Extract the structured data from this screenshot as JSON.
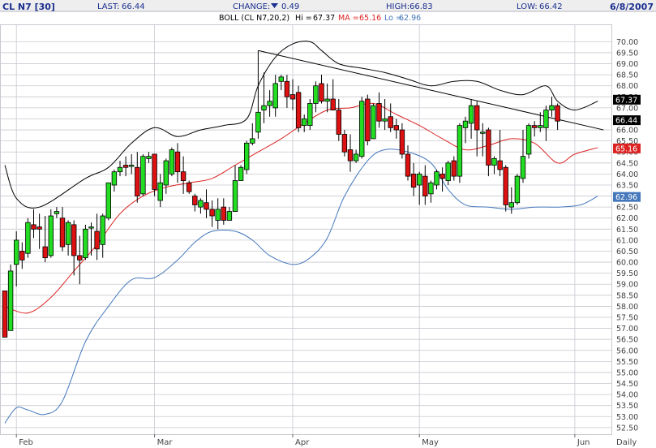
{
  "header": {
    "symbol": "CL N7 [30]",
    "last_label": "LAST:",
    "last_value": "66.44",
    "change_label": "CHANGE:",
    "change_icon": "down-triangle-icon",
    "change_value": "0.49",
    "high_label": "HIGH:",
    "high_value": "66.83",
    "low_label": "LOW:",
    "low_value": "66.42",
    "date": "6/8/2007"
  },
  "indicator": {
    "label": "BOLL (CL N7,20,2)",
    "hi_label": "Hi =",
    "hi_value": "67.37",
    "ma_label": "MA =",
    "ma_value": "65.16",
    "lo_label": "Lo =",
    "lo_value": "62.96"
  },
  "colors": {
    "up_candle": "#22dd22",
    "down_candle": "#dd1111",
    "upper_band": "#000000",
    "middle_band": "#dd2222",
    "lower_band": "#4477bb",
    "trendline": "#000000",
    "header_blue": "#1a2f8f",
    "grid": "#c8c8d0"
  },
  "chart_data": {
    "type": "candlestick",
    "ylim": [
      52.2,
      70.75
    ],
    "y_ticks": [
      "70.00",
      "69.50",
      "69.00",
      "68.50",
      "68.00",
      "67.50",
      "67.00",
      "66.50",
      "66.00",
      "65.50",
      "65.00",
      "64.50",
      "64.00",
      "63.50",
      "63.00",
      "62.50",
      "62.00",
      "61.50",
      "61.00",
      "60.50",
      "60.00",
      "59.50",
      "59.00",
      "58.50",
      "58.00",
      "57.50",
      "57.00",
      "56.50",
      "56.00",
      "55.50",
      "55.00",
      "54.50",
      "54.00",
      "53.50",
      "53.00",
      "52.50"
    ],
    "x_labels": [
      {
        "label": "Feb",
        "index": 2
      },
      {
        "label": "Mar",
        "index": 26
      },
      {
        "label": "Apr",
        "index": 50
      },
      {
        "label": "May",
        "index": 72
      },
      {
        "label": "Jun",
        "index": 99
      }
    ],
    "x_axis_right_label": "Daily",
    "last_markers": {
      "hi": "67.37",
      "last": "66.44",
      "ma": "65.16",
      "lo": "62.96"
    },
    "candles": [
      [
        58.7,
        58.6,
        56.6,
        56.6
      ],
      [
        56.9,
        59.9,
        56.9,
        59.6
      ],
      [
        59.9,
        61.4,
        58.9,
        61.0
      ],
      [
        60.5,
        60.9,
        59.7,
        60.1
      ],
      [
        60.4,
        62.0,
        60.2,
        61.8
      ],
      [
        61.7,
        62.4,
        61.1,
        61.5
      ],
      [
        61.6,
        62.2,
        60.6,
        61.5
      ],
      [
        60.7,
        62.1,
        60.0,
        60.2
      ],
      [
        60.3,
        62.4,
        60.2,
        62.1
      ],
      [
        62.2,
        62.5,
        62.0,
        62.3
      ],
      [
        62.0,
        62.5,
        60.5,
        60.7
      ],
      [
        60.8,
        61.9,
        60.3,
        61.8
      ],
      [
        61.7,
        61.9,
        59.4,
        60.3
      ],
      [
        60.3,
        61.2,
        59.0,
        60.1
      ],
      [
        60.2,
        61.7,
        60.1,
        61.5
      ],
      [
        61.6,
        61.8,
        60.3,
        61.6
      ],
      [
        61.4,
        62.2,
        60.1,
        60.6
      ],
      [
        60.8,
        62.2,
        60.2,
        62.1
      ],
      [
        62.0,
        63.6,
        61.9,
        63.6
      ],
      [
        63.5,
        64.2,
        63.2,
        64.1
      ],
      [
        64.1,
        64.6,
        63.9,
        64.3
      ],
      [
        64.4,
        64.8,
        63.9,
        64.3
      ],
      [
        64.4,
        64.9,
        64.0,
        64.4
      ],
      [
        64.3,
        65.0,
        62.7,
        63.0
      ],
      [
        63.1,
        64.9,
        63.0,
        64.8
      ],
      [
        64.7,
        65.0,
        64.5,
        64.8
      ],
      [
        64.9,
        64.9,
        63.0,
        63.3
      ],
      [
        62.8,
        64.0,
        62.5,
        63.6
      ],
      [
        63.5,
        64.7,
        63.1,
        64.6
      ],
      [
        64.0,
        65.2,
        63.9,
        65.1
      ],
      [
        65.0,
        65.4,
        63.6,
        64.1
      ],
      [
        64.1,
        64.8,
        63.1,
        63.7
      ],
      [
        63.6,
        63.7,
        63.1,
        63.2
      ],
      [
        63.0,
        63.1,
        62.3,
        62.6
      ],
      [
        62.5,
        62.9,
        62.2,
        62.8
      ],
      [
        62.7,
        63.3,
        62.0,
        62.4
      ],
      [
        62.4,
        62.8,
        61.6,
        62.1
      ],
      [
        61.9,
        62.9,
        61.5,
        62.4
      ],
      [
        62.5,
        62.9,
        61.7,
        61.9
      ],
      [
        61.9,
        62.5,
        61.9,
        62.3
      ],
      [
        62.3,
        64.4,
        62.3,
        63.7
      ],
      [
        63.7,
        64.4,
        63.7,
        64.3
      ],
      [
        64.2,
        65.5,
        64.0,
        65.4
      ],
      [
        65.4,
        66.3,
        65.3,
        65.6
      ],
      [
        65.9,
        69.6,
        65.6,
        66.8
      ],
      [
        66.9,
        68.6,
        66.3,
        67.1
      ],
      [
        67.1,
        67.8,
        66.6,
        67.3
      ],
      [
        67.0,
        68.5,
        66.6,
        68.1
      ],
      [
        68.2,
        68.5,
        67.8,
        68.4
      ],
      [
        68.2,
        68.5,
        67.0,
        67.5
      ],
      [
        67.6,
        68.3,
        66.9,
        67.4
      ],
      [
        67.7,
        68.0,
        65.9,
        66.1
      ],
      [
        66.2,
        66.7,
        65.9,
        66.5
      ],
      [
        66.2,
        67.4,
        66.0,
        67.2
      ],
      [
        67.2,
        68.2,
        66.8,
        68.0
      ],
      [
        68.1,
        68.5,
        67.2,
        67.3
      ],
      [
        67.3,
        68.1,
        66.8,
        67.4
      ],
      [
        67.4,
        68.3,
        66.9,
        66.9
      ],
      [
        66.9,
        67.4,
        65.5,
        65.8
      ],
      [
        65.8,
        66.0,
        64.8,
        65.0
      ],
      [
        65.1,
        65.8,
        64.1,
        64.6
      ],
      [
        64.6,
        65.1,
        64.5,
        64.9
      ],
      [
        64.8,
        67.5,
        64.7,
        67.3
      ],
      [
        67.4,
        67.6,
        65.3,
        65.5
      ],
      [
        65.6,
        67.2,
        65.6,
        67.1
      ],
      [
        67.2,
        67.7,
        66.1,
        66.4
      ],
      [
        66.4,
        67.4,
        66.0,
        66.5
      ],
      [
        66.6,
        67.2,
        65.9,
        66.1
      ],
      [
        66.2,
        66.5,
        65.6,
        66.0
      ],
      [
        66.0,
        66.3,
        64.7,
        64.9
      ],
      [
        64.9,
        65.3,
        63.7,
        63.9
      ],
      [
        64.0,
        64.5,
        63.0,
        63.4
      ],
      [
        63.5,
        64.1,
        62.6,
        64.0
      ],
      [
        63.9,
        64.4,
        62.6,
        63.0
      ],
      [
        63.1,
        63.7,
        62.7,
        63.6
      ],
      [
        63.5,
        64.2,
        63.3,
        64.1
      ],
      [
        64.0,
        64.3,
        63.2,
        63.8
      ],
      [
        63.7,
        64.6,
        63.5,
        64.5
      ],
      [
        64.6,
        64.8,
        63.7,
        63.9
      ],
      [
        63.9,
        66.3,
        63.6,
        66.2
      ],
      [
        66.1,
        66.6,
        65.4,
        66.4
      ],
      [
        66.3,
        67.4,
        65.6,
        67.1
      ],
      [
        67.1,
        67.3,
        64.8,
        66.0
      ],
      [
        65.9,
        66.3,
        64.8,
        65.9
      ],
      [
        66.0,
        66.1,
        63.9,
        64.4
      ],
      [
        64.4,
        64.8,
        64.0,
        64.7
      ],
      [
        64.6,
        66.0,
        63.9,
        64.2
      ],
      [
        64.3,
        64.4,
        62.3,
        62.6
      ],
      [
        62.5,
        63.4,
        62.2,
        62.7
      ],
      [
        62.7,
        64.0,
        62.6,
        63.9
      ],
      [
        63.8,
        66.0,
        63.6,
        64.8
      ],
      [
        64.9,
        66.3,
        64.7,
        66.2
      ],
      [
        66.2,
        66.4,
        65.7,
        66.1
      ],
      [
        66.1,
        66.8,
        65.9,
        66.2
      ],
      [
        66.1,
        67.1,
        65.5,
        66.9
      ],
      [
        66.9,
        67.5,
        66.6,
        67.1
      ],
      [
        67.1,
        67.2,
        66.0,
        66.4
      ]
    ],
    "upper_band": [
      [
        0,
        64.4
      ],
      [
        2,
        62.9
      ],
      [
        6,
        62.5
      ],
      [
        14,
        63.8
      ],
      [
        18,
        64.3
      ],
      [
        22,
        65.4
      ],
      [
        26,
        66.1
      ],
      [
        30,
        65.7
      ],
      [
        34,
        66.0
      ],
      [
        38,
        66.2
      ],
      [
        42,
        66.5
      ],
      [
        44,
        68.0
      ],
      [
        47,
        69.3
      ],
      [
        50,
        69.9
      ],
      [
        53,
        70.0
      ],
      [
        55,
        69.6
      ],
      [
        58,
        69.0
      ],
      [
        62,
        68.8
      ],
      [
        66,
        68.6
      ],
      [
        70,
        68.3
      ],
      [
        74,
        68.0
      ],
      [
        78,
        68.2
      ],
      [
        82,
        68.2
      ],
      [
        86,
        67.8
      ],
      [
        90,
        67.6
      ],
      [
        94,
        68.0
      ],
      [
        96,
        67.3
      ],
      [
        99,
        66.9
      ],
      [
        103,
        67.3
      ]
    ],
    "middle_band": [
      [
        0,
        58.0
      ],
      [
        4,
        57.7
      ],
      [
        8,
        58.4
      ],
      [
        12,
        59.6
      ],
      [
        16,
        60.8
      ],
      [
        20,
        62.2
      ],
      [
        24,
        63.0
      ],
      [
        28,
        63.4
      ],
      [
        32,
        63.6
      ],
      [
        36,
        63.8
      ],
      [
        40,
        64.4
      ],
      [
        44,
        65.0
      ],
      [
        48,
        65.6
      ],
      [
        52,
        66.3
      ],
      [
        56,
        66.9
      ],
      [
        60,
        67.0
      ],
      [
        64,
        67.2
      ],
      [
        68,
        66.7
      ],
      [
        72,
        66.2
      ],
      [
        76,
        65.6
      ],
      [
        80,
        65.1
      ],
      [
        84,
        65.3
      ],
      [
        88,
        65.6
      ],
      [
        92,
        65.4
      ],
      [
        96,
        64.5
      ],
      [
        99,
        64.9
      ],
      [
        103,
        65.2
      ]
    ],
    "lower_band": [
      [
        0,
        52.7
      ],
      [
        2,
        53.4
      ],
      [
        4,
        53.3
      ],
      [
        7,
        53.1
      ],
      [
        10,
        53.7
      ],
      [
        14,
        56.4
      ],
      [
        18,
        58.0
      ],
      [
        22,
        59.2
      ],
      [
        26,
        59.3
      ],
      [
        30,
        60.1
      ],
      [
        33,
        60.9
      ],
      [
        36,
        61.4
      ],
      [
        40,
        61.4
      ],
      [
        43,
        61.0
      ],
      [
        46,
        60.3
      ],
      [
        50,
        59.9
      ],
      [
        53,
        60.2
      ],
      [
        56,
        61.1
      ],
      [
        59,
        63.0
      ],
      [
        63,
        64.6
      ],
      [
        66,
        65.1
      ],
      [
        70,
        65.0
      ],
      [
        74,
        64.5
      ],
      [
        77,
        63.3
      ],
      [
        80,
        62.6
      ],
      [
        84,
        62.5
      ],
      [
        88,
        62.4
      ],
      [
        92,
        62.5
      ],
      [
        96,
        62.5
      ],
      [
        100,
        62.6
      ],
      [
        103,
        63.0
      ]
    ],
    "trendline": [
      [
        44,
        69.6
      ],
      [
        104,
        66.0
      ]
    ]
  }
}
